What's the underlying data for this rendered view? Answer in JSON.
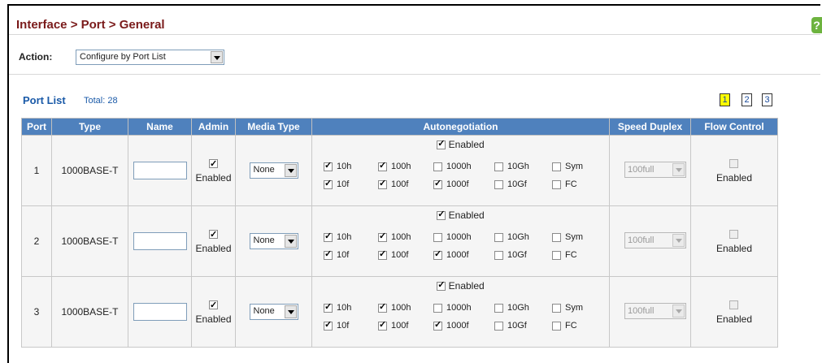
{
  "header": {
    "breadcrumb": "Interface > Port > General",
    "help_glyph": "?"
  },
  "action": {
    "label": "Action:",
    "selected": "Configure by Port List"
  },
  "port_list": {
    "title": "Port List",
    "total": "Total: 28",
    "pages": [
      "1",
      "2",
      "3"
    ],
    "active_page": "1"
  },
  "table": {
    "columns": [
      "Port",
      "Type",
      "Name",
      "Admin",
      "Media Type",
      "Autonegotiation",
      "Speed Duplex",
      "Flow Control"
    ],
    "rows": [
      {
        "port": "1",
        "type": "1000BASE-T",
        "name": "",
        "admin_enabled": true,
        "admin_label": "Enabled",
        "media": "None",
        "autoneg_enabled": true,
        "autoneg_label": "Enabled",
        "caps": [
          {
            "label": "10h",
            "on": true
          },
          {
            "label": "100h",
            "on": true
          },
          {
            "label": "1000h",
            "on": false
          },
          {
            "label": "10Gh",
            "on": false
          },
          {
            "label": "Sym",
            "on": false
          },
          {
            "label": "10f",
            "on": true
          },
          {
            "label": "100f",
            "on": true
          },
          {
            "label": "1000f",
            "on": true
          },
          {
            "label": "10Gf",
            "on": false
          },
          {
            "label": "FC",
            "on": false
          }
        ],
        "speed_duplex": "100full",
        "flow_enabled": false,
        "flow_label": "Enabled"
      },
      {
        "port": "2",
        "type": "1000BASE-T",
        "name": "",
        "admin_enabled": true,
        "admin_label": "Enabled",
        "media": "None",
        "autoneg_enabled": true,
        "autoneg_label": "Enabled",
        "caps": [
          {
            "label": "10h",
            "on": true
          },
          {
            "label": "100h",
            "on": true
          },
          {
            "label": "1000h",
            "on": false
          },
          {
            "label": "10Gh",
            "on": false
          },
          {
            "label": "Sym",
            "on": false
          },
          {
            "label": "10f",
            "on": true
          },
          {
            "label": "100f",
            "on": true
          },
          {
            "label": "1000f",
            "on": true
          },
          {
            "label": "10Gf",
            "on": false
          },
          {
            "label": "FC",
            "on": false
          }
        ],
        "speed_duplex": "100full",
        "flow_enabled": false,
        "flow_label": "Enabled"
      },
      {
        "port": "3",
        "type": "1000BASE-T",
        "name": "",
        "admin_enabled": true,
        "admin_label": "Enabled",
        "media": "None",
        "autoneg_enabled": true,
        "autoneg_label": "Enabled",
        "caps": [
          {
            "label": "10h",
            "on": true
          },
          {
            "label": "100h",
            "on": true
          },
          {
            "label": "1000h",
            "on": false
          },
          {
            "label": "10Gh",
            "on": false
          },
          {
            "label": "Sym",
            "on": false
          },
          {
            "label": "10f",
            "on": true
          },
          {
            "label": "100f",
            "on": true
          },
          {
            "label": "1000f",
            "on": true
          },
          {
            "label": "10Gf",
            "on": false
          },
          {
            "label": "FC",
            "on": false
          }
        ],
        "speed_duplex": "100full",
        "flow_enabled": false,
        "flow_label": "Enabled"
      }
    ]
  }
}
